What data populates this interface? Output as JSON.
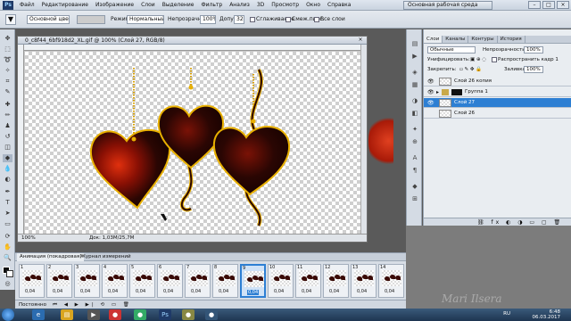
{
  "menubar": {
    "app_logo": "Ps",
    "items": [
      "Файл",
      "Редактирование",
      "Изображение",
      "Слои",
      "Выделение",
      "Фильтр",
      "Анализ",
      "3D",
      "Просмотр",
      "Окно",
      "Справка"
    ],
    "workspace": "Основная рабочая среда",
    "window_buttons": [
      "–",
      "□",
      "×"
    ]
  },
  "options": {
    "fill_source": "Основной цвет",
    "mode_label": "Режим:",
    "mode_value": "Нормальный",
    "opacity_label": "Непрозрачность:",
    "opacity_value": "100%",
    "tolerance_label": "Допуск:",
    "tolerance_value": "32",
    "antialias_label": "Сглаживание",
    "contiguous_label": "Смеж.пикс.",
    "all_layers_label": "Все слои"
  },
  "document": {
    "title": "0_c8f44_6bf918d2_XL.gif @ 100% (Слой 27, RGB/8)",
    "zoom": "100%",
    "doc_size": "Док: 1,03M/25,7M",
    "close": "×"
  },
  "layers": {
    "tabs": [
      "Слои",
      "Каналы",
      "Контуры",
      "История"
    ],
    "blend_mode": "Обычные",
    "opacity_label": "Непрозрачность:",
    "opacity_value": "100%",
    "unify_label": "Унифицировать:",
    "propagate_label": "Распространить кадр 1",
    "lock_label": "Закрепить:",
    "fill_label": "Заливка:",
    "fill_value": "100%",
    "items": [
      {
        "name": "Слой 26 копия",
        "visible": true,
        "selected": false
      },
      {
        "name": "Группа 1",
        "visible": true,
        "selected": false
      },
      {
        "name": "Слой 27",
        "visible": true,
        "selected": true
      },
      {
        "name": "Слой 26",
        "visible": false,
        "selected": false
      }
    ]
  },
  "animation": {
    "tabs": [
      "Анимация (покадровая)",
      "Журнал измерений"
    ],
    "frames": [
      {
        "num": "1",
        "delay": "0,04"
      },
      {
        "num": "2",
        "delay": "0,04"
      },
      {
        "num": "3",
        "delay": "0,04"
      },
      {
        "num": "4",
        "delay": "0,04"
      },
      {
        "num": "5",
        "delay": "0,04"
      },
      {
        "num": "6",
        "delay": "0,04"
      },
      {
        "num": "7",
        "delay": "0,04"
      },
      {
        "num": "8",
        "delay": "0,04"
      },
      {
        "num": "9",
        "delay": "0,04"
      },
      {
        "num": "10",
        "delay": "0,04"
      },
      {
        "num": "11",
        "delay": "0,04"
      },
      {
        "num": "12",
        "delay": "0,04"
      },
      {
        "num": "13",
        "delay": "0,04"
      },
      {
        "num": "14",
        "delay": "0,04"
      }
    ],
    "selected_frame": 9,
    "loop_label": "Постоянно"
  },
  "watermark": "Mari Ilsera",
  "taskbar": {
    "lang": "RU",
    "time": "6:48",
    "date": "06.03.2017"
  },
  "colors": {
    "accent": "#2d7fd3",
    "heart_dark": "#2a0603",
    "heart_red": "#c0200a",
    "heart_outline": "#e8b000"
  }
}
